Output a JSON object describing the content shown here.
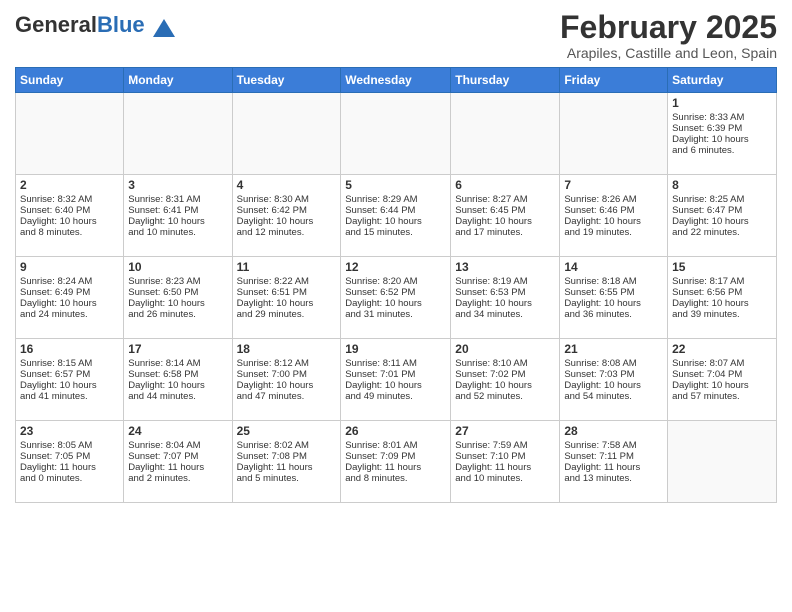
{
  "header": {
    "logo": {
      "general": "General",
      "blue": "Blue"
    },
    "title": "February 2025",
    "location": "Arapiles, Castille and Leon, Spain"
  },
  "weekdays": [
    "Sunday",
    "Monday",
    "Tuesday",
    "Wednesday",
    "Thursday",
    "Friday",
    "Saturday"
  ],
  "weeks": [
    [
      {
        "day": "",
        "info": ""
      },
      {
        "day": "",
        "info": ""
      },
      {
        "day": "",
        "info": ""
      },
      {
        "day": "",
        "info": ""
      },
      {
        "day": "",
        "info": ""
      },
      {
        "day": "",
        "info": ""
      },
      {
        "day": "1",
        "info": "Sunrise: 8:33 AM\nSunset: 6:39 PM\nDaylight: 10 hours\nand 6 minutes."
      }
    ],
    [
      {
        "day": "2",
        "info": "Sunrise: 8:32 AM\nSunset: 6:40 PM\nDaylight: 10 hours\nand 8 minutes."
      },
      {
        "day": "3",
        "info": "Sunrise: 8:31 AM\nSunset: 6:41 PM\nDaylight: 10 hours\nand 10 minutes."
      },
      {
        "day": "4",
        "info": "Sunrise: 8:30 AM\nSunset: 6:42 PM\nDaylight: 10 hours\nand 12 minutes."
      },
      {
        "day": "5",
        "info": "Sunrise: 8:29 AM\nSunset: 6:44 PM\nDaylight: 10 hours\nand 15 minutes."
      },
      {
        "day": "6",
        "info": "Sunrise: 8:27 AM\nSunset: 6:45 PM\nDaylight: 10 hours\nand 17 minutes."
      },
      {
        "day": "7",
        "info": "Sunrise: 8:26 AM\nSunset: 6:46 PM\nDaylight: 10 hours\nand 19 minutes."
      },
      {
        "day": "8",
        "info": "Sunrise: 8:25 AM\nSunset: 6:47 PM\nDaylight: 10 hours\nand 22 minutes."
      }
    ],
    [
      {
        "day": "9",
        "info": "Sunrise: 8:24 AM\nSunset: 6:49 PM\nDaylight: 10 hours\nand 24 minutes."
      },
      {
        "day": "10",
        "info": "Sunrise: 8:23 AM\nSunset: 6:50 PM\nDaylight: 10 hours\nand 26 minutes."
      },
      {
        "day": "11",
        "info": "Sunrise: 8:22 AM\nSunset: 6:51 PM\nDaylight: 10 hours\nand 29 minutes."
      },
      {
        "day": "12",
        "info": "Sunrise: 8:20 AM\nSunset: 6:52 PM\nDaylight: 10 hours\nand 31 minutes."
      },
      {
        "day": "13",
        "info": "Sunrise: 8:19 AM\nSunset: 6:53 PM\nDaylight: 10 hours\nand 34 minutes."
      },
      {
        "day": "14",
        "info": "Sunrise: 8:18 AM\nSunset: 6:55 PM\nDaylight: 10 hours\nand 36 minutes."
      },
      {
        "day": "15",
        "info": "Sunrise: 8:17 AM\nSunset: 6:56 PM\nDaylight: 10 hours\nand 39 minutes."
      }
    ],
    [
      {
        "day": "16",
        "info": "Sunrise: 8:15 AM\nSunset: 6:57 PM\nDaylight: 10 hours\nand 41 minutes."
      },
      {
        "day": "17",
        "info": "Sunrise: 8:14 AM\nSunset: 6:58 PM\nDaylight: 10 hours\nand 44 minutes."
      },
      {
        "day": "18",
        "info": "Sunrise: 8:12 AM\nSunset: 7:00 PM\nDaylight: 10 hours\nand 47 minutes."
      },
      {
        "day": "19",
        "info": "Sunrise: 8:11 AM\nSunset: 7:01 PM\nDaylight: 10 hours\nand 49 minutes."
      },
      {
        "day": "20",
        "info": "Sunrise: 8:10 AM\nSunset: 7:02 PM\nDaylight: 10 hours\nand 52 minutes."
      },
      {
        "day": "21",
        "info": "Sunrise: 8:08 AM\nSunset: 7:03 PM\nDaylight: 10 hours\nand 54 minutes."
      },
      {
        "day": "22",
        "info": "Sunrise: 8:07 AM\nSunset: 7:04 PM\nDaylight: 10 hours\nand 57 minutes."
      }
    ],
    [
      {
        "day": "23",
        "info": "Sunrise: 8:05 AM\nSunset: 7:05 PM\nDaylight: 11 hours\nand 0 minutes."
      },
      {
        "day": "24",
        "info": "Sunrise: 8:04 AM\nSunset: 7:07 PM\nDaylight: 11 hours\nand 2 minutes."
      },
      {
        "day": "25",
        "info": "Sunrise: 8:02 AM\nSunset: 7:08 PM\nDaylight: 11 hours\nand 5 minutes."
      },
      {
        "day": "26",
        "info": "Sunrise: 8:01 AM\nSunset: 7:09 PM\nDaylight: 11 hours\nand 8 minutes."
      },
      {
        "day": "27",
        "info": "Sunrise: 7:59 AM\nSunset: 7:10 PM\nDaylight: 11 hours\nand 10 minutes."
      },
      {
        "day": "28",
        "info": "Sunrise: 7:58 AM\nSunset: 7:11 PM\nDaylight: 11 hours\nand 13 minutes."
      },
      {
        "day": "",
        "info": ""
      }
    ]
  ]
}
